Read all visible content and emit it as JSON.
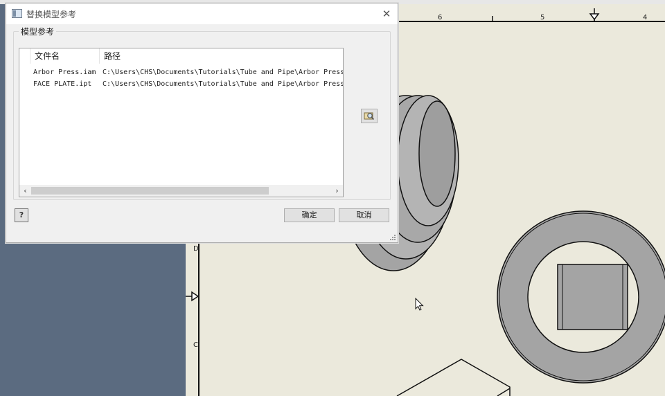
{
  "background": {
    "ruler_numbers": [
      "6",
      "5",
      "4"
    ],
    "zone_letters": [
      "D",
      "C"
    ],
    "colors": {
      "sheet": "#ebe9dc",
      "workspace": "#5b6b80",
      "part": "#a4a4a4",
      "part_hole": "#ebe9dc"
    }
  },
  "dialog": {
    "title": "替换模型参考",
    "close_icon": "close-icon",
    "group_label": "模型参考",
    "columns": {
      "name": "文件名",
      "path": "路径"
    },
    "rows": [
      {
        "name": "Arbor Press.iam",
        "path": "C:\\Users\\CHS\\Documents\\Tutorials\\Tube and Pipe\\Arbor Press"
      },
      {
        "name": "FACE PLATE.ipt",
        "path": "C:\\Users\\CHS\\Documents\\Tutorials\\Tube and Pipe\\Arbor Press"
      }
    ],
    "scroll": {
      "left_icon": "‹",
      "right_icon": "›"
    },
    "browse_icon": "browse-folder-icon",
    "help_label": "?",
    "ok_label": "确定",
    "cancel_label": "取消"
  }
}
